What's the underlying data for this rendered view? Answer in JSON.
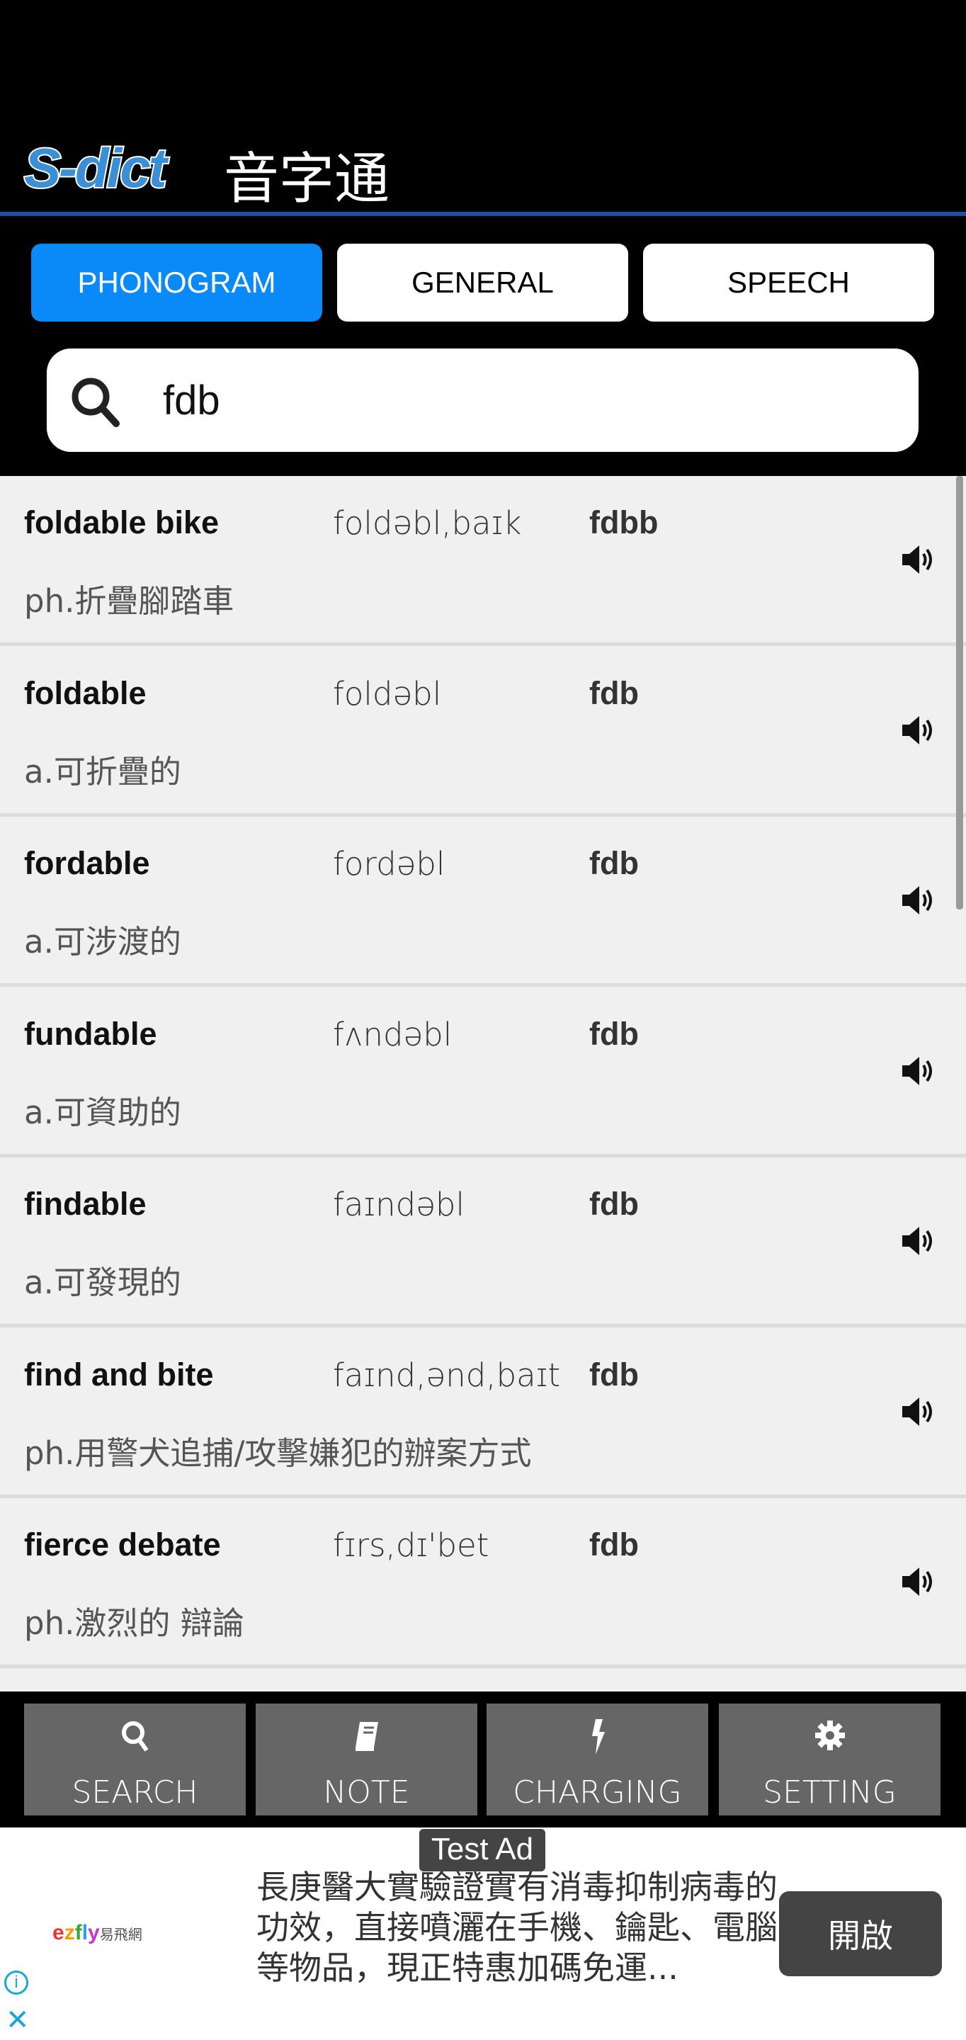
{
  "header": {
    "logo_text": "S-dict",
    "title_cn": "音字通"
  },
  "tabs": [
    {
      "label": "PHONOGRAM",
      "active": true
    },
    {
      "label": "GENERAL",
      "active": false
    },
    {
      "label": "SPEECH",
      "active": false
    }
  ],
  "search": {
    "value": "fdb",
    "icon": "search-icon"
  },
  "results": [
    {
      "word": "foldable bike",
      "phonetic": "foldəbl,baɪk",
      "code": "fdbb",
      "definition": "ph.折疊腳踏車"
    },
    {
      "word": "foldable",
      "phonetic": "foldəbl",
      "code": "fdb",
      "definition": "a.可折疊的"
    },
    {
      "word": "fordable",
      "phonetic": "fordəbl",
      "code": "fdb",
      "definition": "a.可涉渡的"
    },
    {
      "word": "fundable",
      "phonetic": "fʌndəbl",
      "code": "fdb",
      "definition": "a.可資助的"
    },
    {
      "word": "findable",
      "phonetic": "faɪndəbl",
      "code": "fdb",
      "definition": "a.可發現的"
    },
    {
      "word": "find and bite",
      "phonetic": "faɪnd,ənd,baɪt",
      "code": "fdb",
      "definition": "ph.用警犬追捕/攻擊嫌犯的辦案方式"
    },
    {
      "word": "fierce debate",
      "phonetic": "fɪrs,dɪ'bet",
      "code": "fdb",
      "definition": "ph.激烈的 辯論"
    }
  ],
  "bottom_nav": [
    {
      "label": "SEARCH",
      "icon": "search-icon"
    },
    {
      "label": "NOTE",
      "icon": "book-icon"
    },
    {
      "label": "CHARGING",
      "icon": "bolt-icon"
    },
    {
      "label": "SETTING",
      "icon": "gear-icon"
    }
  ],
  "ad": {
    "tag": "Test Ad",
    "advertiser": "ezfly易飛網",
    "text": "長庚醫大實驗證實有消毒抑制病毒的功效，直接噴灑在手機、鑰匙、電腦等物品，現正特惠加碼免運...",
    "button": "開啟"
  },
  "colors": {
    "accent": "#0a8af8",
    "header_line": "#1a4fae",
    "nav_button": "#666666"
  }
}
